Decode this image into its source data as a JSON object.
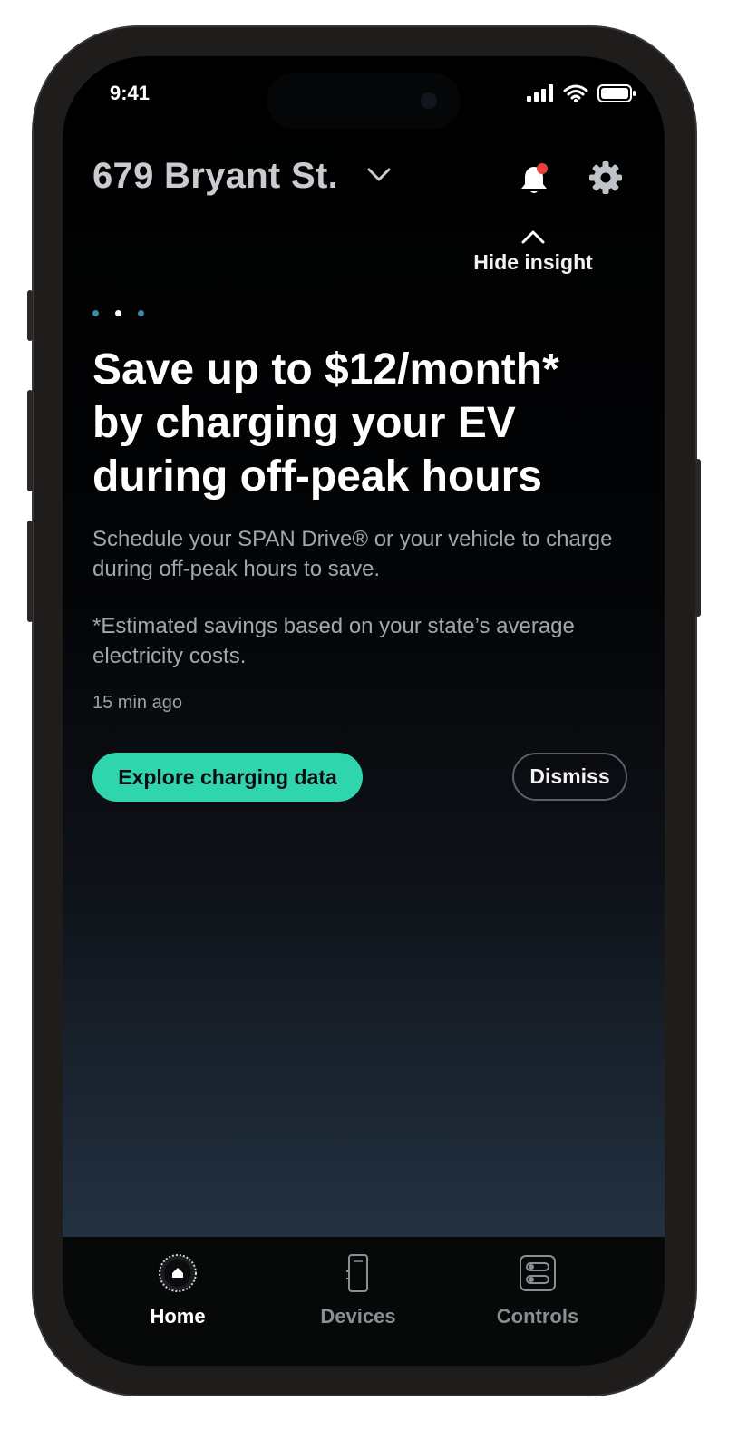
{
  "status_bar": {
    "time": "9:41"
  },
  "header": {
    "address": "679 Bryant St."
  },
  "insight": {
    "hide_label": "Hide insight",
    "pager": {
      "count": 3,
      "active_index": 1
    },
    "headline": "Save up to $12/month* by charging your EV during off-peak hours",
    "body": "Schedule your SPAN Drive® or your vehicle to charge during off-peak hours to save.",
    "footnote": "*Estimated savings based on your state’s average electricity costs.",
    "timestamp": "15 min ago",
    "primary_button": "Explore charging data",
    "secondary_button": "Dismiss"
  },
  "tabs": [
    {
      "label": "Home",
      "icon": "home-icon",
      "active": true
    },
    {
      "label": "Devices",
      "icon": "devices-icon",
      "active": false
    },
    {
      "label": "Controls",
      "icon": "controls-icon",
      "active": false
    }
  ],
  "colors": {
    "accent": "#2fd6ad",
    "notification_dot": "#e8423c",
    "pager_dot_inactive": "#3f86a8",
    "pager_dot_active": "#ffffff"
  }
}
